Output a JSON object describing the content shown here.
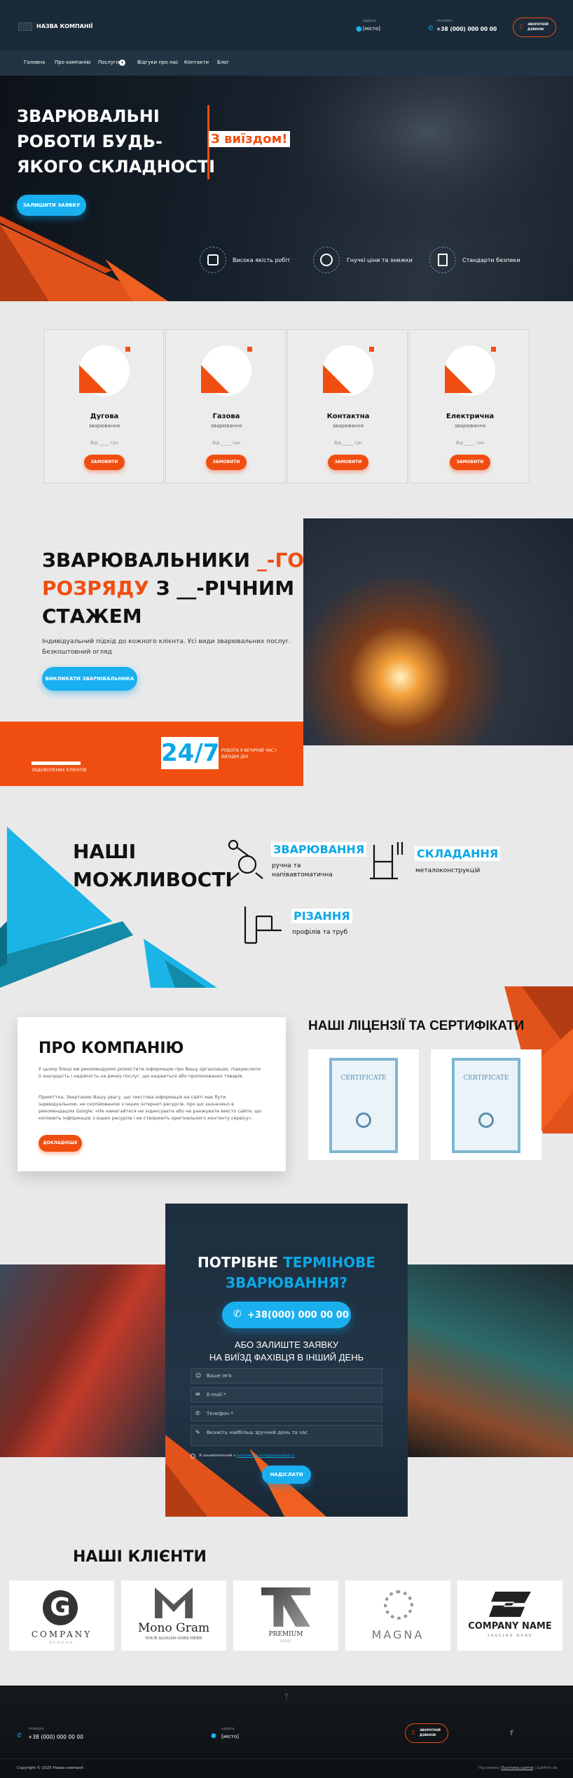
{
  "header": {
    "company_name": "НАЗВА КОМПАНІЇ",
    "address_label": "адреса",
    "address_value": "[місто]",
    "phone_label": "телефон",
    "phone_value": "+38 (000) 000 00 00",
    "callback_line1": "ЗВОРОТНІЙ",
    "callback_line2": "ДЗВІНОК"
  },
  "nav": {
    "items": [
      "Головна",
      "Про компанію",
      "Послуги",
      "Відгуки про нас",
      "Контакти",
      "Блог"
    ]
  },
  "hero": {
    "title_line1": "ЗВАРЮВАЛЬНІ",
    "title_line2": "РОБОТИ БУДЬ-",
    "title_line3": "ЯКОГО СКЛАДНОСТІ",
    "badge": "З виїздом!",
    "cta": "ЗАЛИШИТИ ЗАЯВКУ",
    "features": [
      "Висока якість робіт",
      "Гнучкі ціни та знижки",
      "Стандарти безпеки"
    ]
  },
  "services": [
    {
      "title": "Дугова",
      "subtitle": "зварювання",
      "price": "Від _____ грн",
      "button": "ЗАМОВИТИ"
    },
    {
      "title": "Газова",
      "subtitle": "зварювання",
      "price": "Від _____ грн",
      "button": "ЗАМОВИТИ"
    },
    {
      "title": "Контактна",
      "subtitle": "зварювання",
      "price": "Від _____ грн",
      "button": "ЗАМОВИТИ"
    },
    {
      "title": "Електрична",
      "subtitle": "зварювання",
      "price": "Від _____ грн",
      "button": "ЗАМОВИТИ"
    }
  ],
  "welders": {
    "line1a": "ЗВАРЮВАЛЬНИКИ ",
    "line1b": "_-ГО",
    "line2a": "РОЗРЯДУ",
    "line2b": " З __-РІЧНИМ",
    "line3": "СТАЖЕМ",
    "desc1": "Індивідуальний підхід до кожного клієнта. Усі види зварювальних послуг.",
    "desc2": "Безкоштовний огляд",
    "cta": "ВИКЛИКАТИ ЗВАРЮВАЛЬНИКА",
    "clients_label": "ЗАДОВОЛЕНИХ КЛІЄНТІВ",
    "h247": "24/7",
    "work_line1": "РОБОТА У ВЕЧІРНІЙ ЧАС І",
    "work_line2": "ВИХІДНІ ДНІ"
  },
  "capabilities": {
    "title_line1": "НАШІ",
    "title_line2": "МОЖЛИВОСТІ",
    "items": [
      {
        "title": "ЗВАРЮВАННЯ",
        "desc1": "ручна та",
        "desc2": "напівавтоматична"
      },
      {
        "title": "СКЛАДАННЯ",
        "desc1": "металоконструкцій",
        "desc2": ""
      },
      {
        "title": "РІЗАННЯ",
        "desc1": "профілів та труб",
        "desc2": ""
      }
    ]
  },
  "about": {
    "title": "ПРО КОМПАНІЮ",
    "p1": "У цьому блоці ми рекомендуємо розмістити інформацію про Вашу організацію, підкреслити її значущість і надійність на ринку послуг, що надаються або пропонованих товарів.",
    "p2": "Приміттка. Звертаємо Вашу увагу, що текстова інформація на сайті має бути індивідуальною, не скопійованою з інших інтернет-ресурсів, про що зазначено в рекомендаціях Google: «Не намагайтеся не індексувати або не ранжувати вмісто сайти, що копіюють інформацію з інших ресурсів і не створюють оригінального контенту сервісу».",
    "button": "ДОКЛАДНІШЕ",
    "licenses_title": "НАШІ ЛІЦЕНЗІЇ ТА СЕРТИФІКАТИ",
    "cert_word": "CERTIFICATE"
  },
  "urgent": {
    "title_a": "ПОТРІБНЕ ",
    "title_b": "ТЕРМІНОВЕ",
    "title_c": "ЗВАРЮВАННЯ?",
    "phone": "+38(000) 000 00 00",
    "or_line1": "АБО ЗАЛИШТЕ ЗАЯВКУ",
    "or_line2": "НА ВИЇЗД ФАХІВЦЯ В ІНШИЙ ДЕНЬ",
    "name_ph": "Ваше ім'я",
    "email_ph": "E-mail *",
    "phone_ph": "Телефон *",
    "time_ph": "Вкажіть найбільш зручний день та час",
    "consent_a": "Я ознайомлений з ",
    "consent_b": "політикою конфіденційності",
    "submit": "НАДІСЛАТИ"
  },
  "clients": {
    "title": "НАШІ КЛІЄНТИ",
    "logos": [
      {
        "name": "COMPANY",
        "tag": "SLOGAN"
      },
      {
        "name": "Mono Gram",
        "tag": "YOUR SLOGAN GOES HERE"
      },
      {
        "name": "PREMIUM",
        "tag": "LOGO"
      },
      {
        "name": "MAGNA",
        "tag": ""
      },
      {
        "name": "COMPANY NAME",
        "tag": "TAGLINE HERE"
      }
    ]
  },
  "footer": {
    "phone_label": "телефон",
    "phone_value": "+38 (000) 000 00 00",
    "address_label": "адреса",
    "address_value": "[місто]",
    "callback_line1": "ЗВОРОТНІЙ",
    "callback_line2": "ДЗВІНОК",
    "copyright": "Copyright © 2025 Назва компанії",
    "legal_a": "Підтримка  ",
    "legal_b": "Політика сайтів",
    "legal_c": "  |  Gotfirm.de"
  },
  "colors": {
    "accent": "#f04e10",
    "blue": "#1ab0f0",
    "dark": "#1b2a38"
  }
}
